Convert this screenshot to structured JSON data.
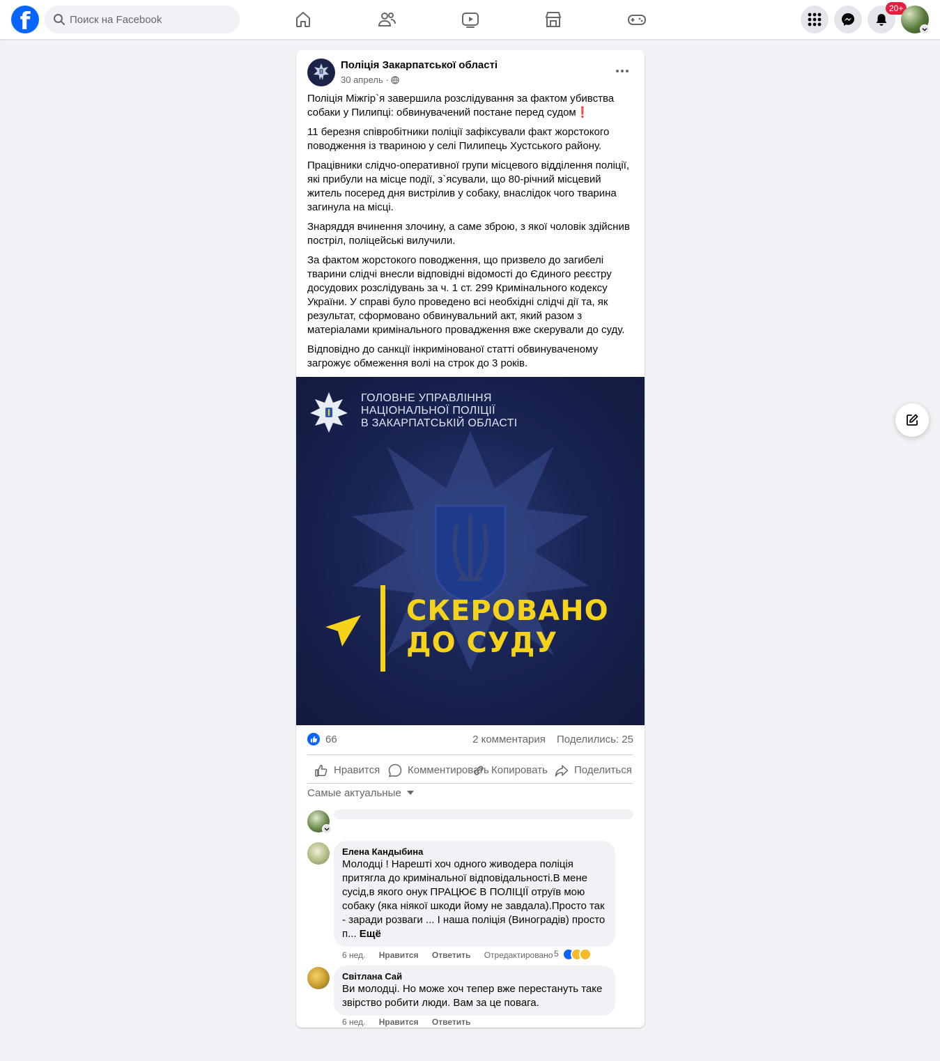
{
  "topbar": {
    "logo": "f",
    "search_placeholder": "Поиск на Facebook",
    "nav_icons": [
      "home-icon",
      "friends-icon",
      "watch-icon",
      "marketplace-icon",
      "gaming-icon"
    ],
    "notifications_badge": "20+"
  },
  "post": {
    "page_name": "Поліція Закарпатської області",
    "date": "30 апрель",
    "paragraphs": [
      "Поліція Міжгір`я завершила розслідування за фактом убивства собаки у Пилипці: обвинувачений постане перед судом",
      "11 березня співробітники поліції зафіксували факт жорстокого поводження із твариною у селі Пилипець Хустського району.",
      "Працівники слідчо-оперативної групи місцевого відділення поліції, які прибули на місце події, з`ясували, що 80-річний місцевий житель посеред дня вистрілив у собаку, внаслідок чого тварина загинула на місці.",
      "Знаряддя вчинення злочину, а саме зброю, з якої чоловік здійснив постріл, поліцейські вилучили.",
      "За фактом жорстокого поводження, що призвело до загибелі тварини слідчі внесли відповідні відомості до Єдиного реєстру досудових розслідувань за ч. 1 ст. 299 Кримінального кодексу України. У справі було проведено всі необхідні слідчі дії та, як результат, сформовано обвинувальний акт, який разом з матеріалами кримінального провадження вже скерували до суду.",
      "Відповідно до санкції інкримінованої статті обвинуваченому загрожує обмеження волі на строк до 3 років."
    ],
    "first_paragraph_emoji": "❗",
    "image": {
      "header_lines": [
        "ГОЛОВНЕ УПРАВЛІННЯ",
        "НАЦІОНАЛЬНОЇ ПОЛІЦІЇ",
        "В ЗАКАРПАТСЬКІЙ ОБЛАСТІ"
      ],
      "big_lines": [
        "СКЕРОВАНО",
        "ДО СУДУ"
      ],
      "accent_color": "#f5d31a",
      "background_color": "#1a2455"
    },
    "likes": "66",
    "comments_count": "2 комментария",
    "shares": "Поделились: 25",
    "actions": {
      "like": "Нравится",
      "comment": "Комментировать",
      "copy": "Копировать",
      "share": "Поделиться"
    },
    "sort_label": "Самые актуальные"
  },
  "comments": [
    {
      "author": "Елена Кандыбина",
      "text": "Молодці ! Нарешті хоч одного живодера поліція притягла до кримінальної відповідальності.В мене сусід,в якого онук ПРАЦЮЄ В ПОЛІЦІЇ отруїв мою собаку (яка ніякої шкоди йому не завдала).Просто так - заради розваги ... І наша поліція (Виноградів) просто п...",
      "more": "Ещё",
      "time": "6 нед.",
      "like": "Нравится",
      "reply": "Ответить",
      "edited": "Отредактировано",
      "reactions_count": "5"
    },
    {
      "author": "Світлана Сай",
      "text": "Ви молодці. Но може хоч тепер вже перестануть таке звірство робити люди. Вам за це повага.",
      "time": "6 нед.",
      "like": "Нравится",
      "reply": "Ответить"
    }
  ]
}
